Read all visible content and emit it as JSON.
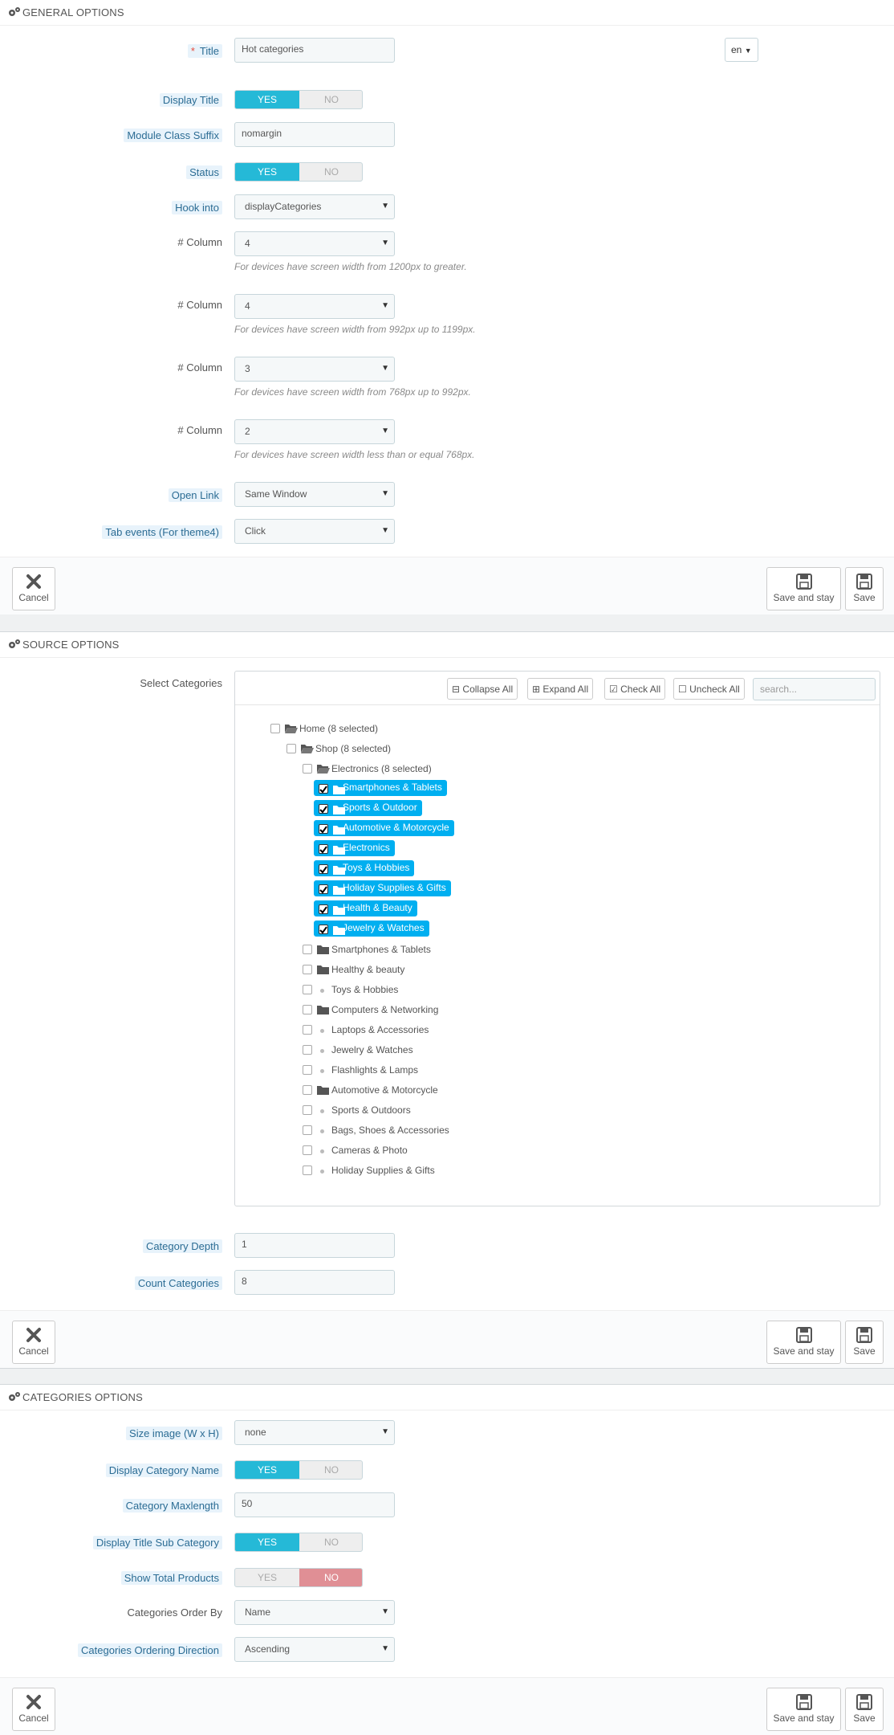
{
  "general": {
    "heading": "GENERAL OPTIONS",
    "title_label": "Title",
    "title_required": "*",
    "title_value": "Hot categories",
    "lang": "en",
    "display_title_label": "Display Title",
    "yes": "YES",
    "no": "NO",
    "suffix_label": "Module Class Suffix",
    "suffix_value": "nomargin",
    "status_label": "Status",
    "hook_label": "Hook into",
    "hook_value": "displayCategories",
    "columns": [
      {
        "label": "# Column",
        "value": "4",
        "help": "For devices have screen width from 1200px to greater."
      },
      {
        "label": "# Column",
        "value": "4",
        "help": "For devices have screen width from 992px up to 1199px."
      },
      {
        "label": "# Column",
        "value": "3",
        "help": "For devices have screen width from 768px up to 992px."
      },
      {
        "label": "# Column",
        "value": "2",
        "help": "For devices have screen width less than or equal 768px."
      }
    ],
    "open_link_label": "Open Link",
    "open_link_value": "Same Window",
    "tab_events_label": "Tab events (For theme4)",
    "tab_events_value": "Click"
  },
  "buttons": {
    "cancel": "Cancel",
    "save_stay": "Save and stay",
    "save": "Save"
  },
  "source": {
    "heading": "SOURCE OPTIONS",
    "select_label": "Select Categories",
    "collapse_all": "Collapse All",
    "expand_all": "Expand All",
    "check_all": "Check All",
    "uncheck_all": "Uncheck All",
    "search_placeholder": "search...",
    "tree": {
      "home": "Home (8 selected)",
      "shop": "Shop (8 selected)",
      "electronics_parent": "Electronics (8 selected)",
      "selected": [
        "Smartphones & Tablets",
        "Sports & Outdoor",
        "Automotive & Motorcycle",
        "Electronics",
        "Toys & Hobbies",
        "Holiday Supplies & Gifts",
        "Health & Beauty",
        "Jewelry & Watches"
      ],
      "others": [
        {
          "label": "Smartphones & Tablets",
          "type": "folder"
        },
        {
          "label": "Healthy & beauty",
          "type": "folder"
        },
        {
          "label": "Toys & Hobbies",
          "type": "leaf"
        },
        {
          "label": "Computers & Networking",
          "type": "folder"
        },
        {
          "label": "Laptops & Accessories",
          "type": "leaf"
        },
        {
          "label": "Jewelry & Watches",
          "type": "leaf"
        },
        {
          "label": "Flashlights & Lamps",
          "type": "leaf"
        },
        {
          "label": "Automotive & Motorcycle",
          "type": "folder"
        },
        {
          "label": "Sports & Outdoors",
          "type": "leaf"
        },
        {
          "label": "Bags, Shoes & Accessories",
          "type": "leaf"
        },
        {
          "label": "Cameras & Photo",
          "type": "leaf"
        },
        {
          "label": "Holiday Supplies & Gifts",
          "type": "leaf"
        }
      ]
    },
    "depth_label": "Category Depth",
    "depth_value": "1",
    "count_label": "Count Categories",
    "count_value": "8"
  },
  "categories": {
    "heading": "CATEGORIES OPTIONS",
    "size_label": "Size image (W x H)",
    "size_value": "none",
    "display_name_label": "Display Category Name",
    "maxlength_label": "Category Maxlength",
    "maxlength_value": "50",
    "sub_title_label": "Display Title Sub Category",
    "total_label": "Show Total Products",
    "order_by_label": "Categories Order By",
    "order_by_value": "Name",
    "direction_label": "Categories Ordering Direction",
    "direction_value": "Ascending"
  }
}
